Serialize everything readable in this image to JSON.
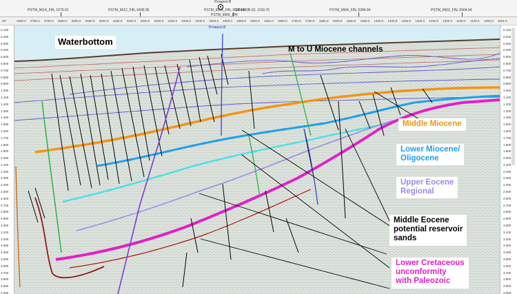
{
  "header": {
    "line_refs": [
      "PSTM_9614_FIN, 1579.91",
      "PSTM_9612_FIN, 6436.95",
      "PSTM_9588_FIN, 9036.99",
      "EP4490B-02, 1159.76",
      "PSTM_9604_FIN, 6284.94",
      "PSTM_9602_FIN, 6904.94"
    ],
    "prospect_marker": "Prospect B",
    "prospect_line": "PSTM_9665_FIN",
    "prospect_label": "Prospect B",
    "sp_label": "SP",
    "shotpoints": [
      "2800.0",
      "2750.0",
      "2700.0",
      "2650.0",
      "2600.0",
      "2550.0",
      "2500.0",
      "2450.0",
      "2400.0",
      "2350.0",
      "2300.0",
      "2250.0",
      "2200.0",
      "2100.0",
      "2050.0",
      "2000.0",
      "1950.0",
      "1900.0",
      "1850.0",
      "1800.0",
      "1750.0",
      "1700.0",
      "1650.0",
      "1600.0",
      "1550.0",
      "1500.0",
      "1450.0",
      "1400.0",
      "1350.0",
      "1300.0",
      "1250.0",
      "1200.0",
      "1150.0",
      "1100.0",
      "1050.0",
      "1001.0"
    ]
  },
  "time_axis": [
    "0.100",
    "0.200",
    "0.300",
    "0.400",
    "0.500",
    "0.600",
    "0.700",
    "0.800",
    "0.900",
    "1.000",
    "1.100",
    "1.200",
    "1.300",
    "1.400",
    "1.500",
    "1.600",
    "1.700",
    "1.800",
    "1.900",
    "2.000",
    "2.100",
    "2.200",
    "2.300",
    "2.400",
    "2.500",
    "2.600",
    "2.700",
    "2.800",
    "2.900",
    "3.000",
    "3.100",
    "3.200",
    "3.300",
    "3.400",
    "3.500",
    "3.600",
    "3.700",
    "3.800",
    "3.900",
    "4.000"
  ],
  "labels": {
    "waterbottom": "Waterbottom",
    "channels": "M to U Miocene channels",
    "middle_miocene": "Middle Miocene",
    "lower_miocene_1": "Lower Miocene/",
    "lower_miocene_2": "Oligocene",
    "upper_eocene_1": "Upper Eocene",
    "upper_eocene_2": "Regional",
    "middle_eocene_1": "Middle Eocene",
    "middle_eocene_2": "potential reservoir",
    "middle_eocene_3": "sands",
    "cretaceous_1": "Lower Cretaceous",
    "cretaceous_2": "unconformity",
    "cretaceous_3": "with Paleozoic"
  },
  "colors": {
    "middle_miocene": "#f39414",
    "lower_miocene": "#1ea0ea",
    "upper_eocene": "#9a8be8",
    "middle_eocene": "#000000",
    "cretaceous": "#e020c8",
    "water": "#d8eef6",
    "seismic_base": "#e6ebe6"
  }
}
